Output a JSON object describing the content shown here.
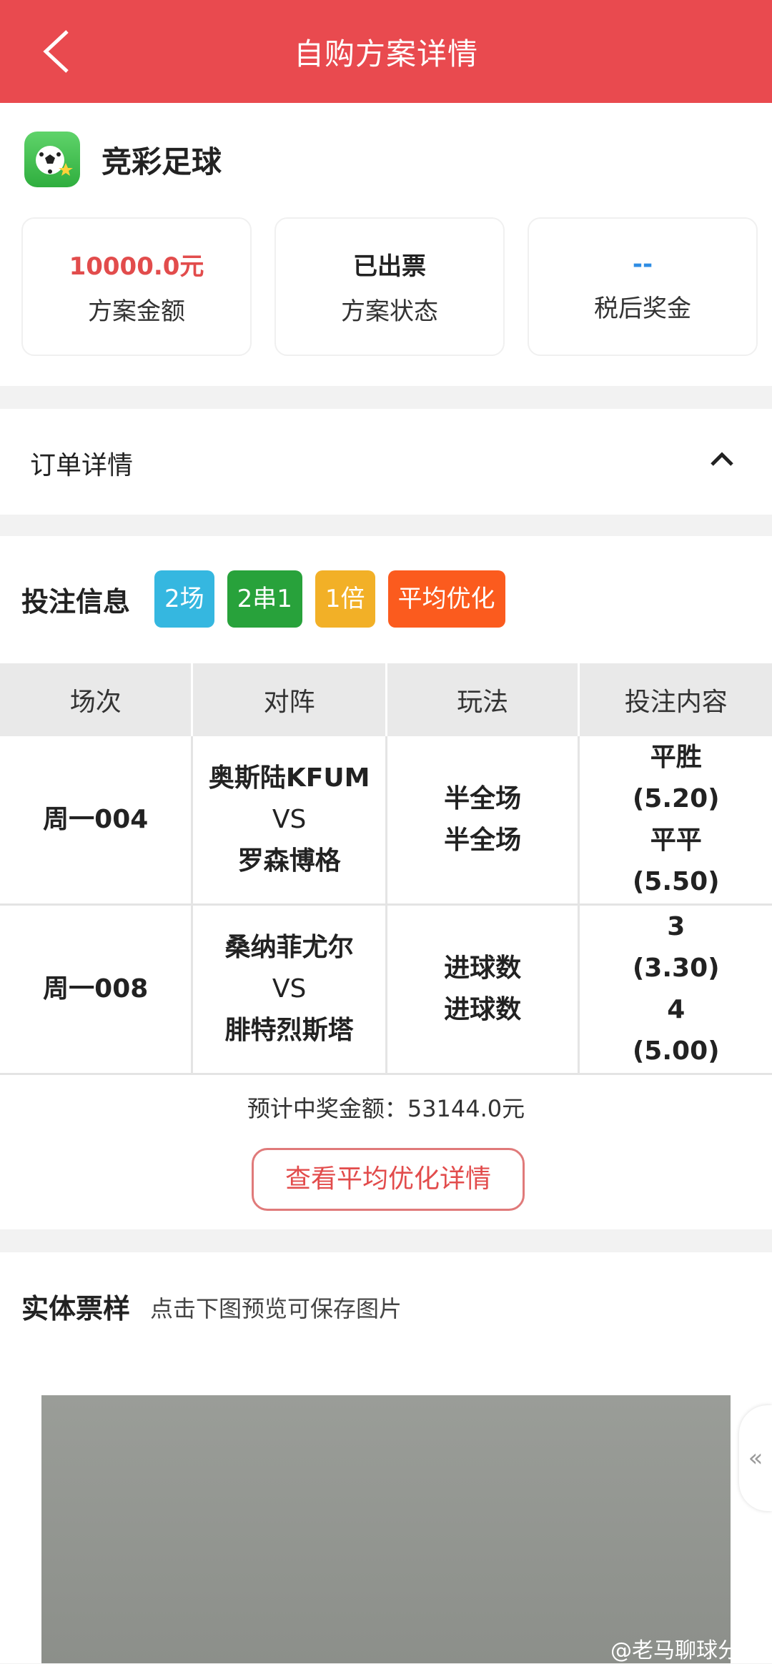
{
  "header": {
    "title": "自购方案详情"
  },
  "app": {
    "name": "竞彩足球"
  },
  "stats": [
    {
      "value": "10000.0元",
      "label": "方案金额",
      "color": "#e24c4c"
    },
    {
      "value": "已出票",
      "label": "方案状态",
      "color": "#222222"
    },
    {
      "value": "--",
      "label": "税后奖金",
      "color": "#2f8de4"
    }
  ],
  "order": {
    "title": "订单详情"
  },
  "bet": {
    "title": "投注信息",
    "tags": [
      {
        "label": "2场",
        "color": "#35b7e0"
      },
      {
        "label": "2串1",
        "color": "#28a23b"
      },
      {
        "label": "1倍",
        "color": "#f2b027"
      },
      {
        "label": "平均优化",
        "color": "#fb5b1e"
      }
    ],
    "columns": [
      "场次",
      "对阵",
      "玩法",
      "投注内容"
    ],
    "rows": [
      {
        "match": "周一004",
        "teams": [
          "奥斯陆KFUM",
          "VS",
          "罗森博格"
        ],
        "plays": [
          "半全场",
          "半全场"
        ],
        "content": [
          "平胜",
          "(5.20)",
          "平平",
          "(5.50)"
        ]
      },
      {
        "match": "周一008",
        "teams": [
          "桑纳菲尤尔",
          "VS",
          "腓特烈斯塔"
        ],
        "plays": [
          "进球数",
          "进球数"
        ],
        "content": [
          "3",
          "(3.30)",
          "4",
          "(5.00)"
        ]
      }
    ],
    "estimate": "预计中奖金额：53144.0元",
    "optimize_button": "查看平均优化详情"
  },
  "ticket": {
    "title": "实体票样",
    "hint": "点击下图预览可保存图片"
  },
  "side_tab": "«",
  "watermark": "@老马聊球分析"
}
